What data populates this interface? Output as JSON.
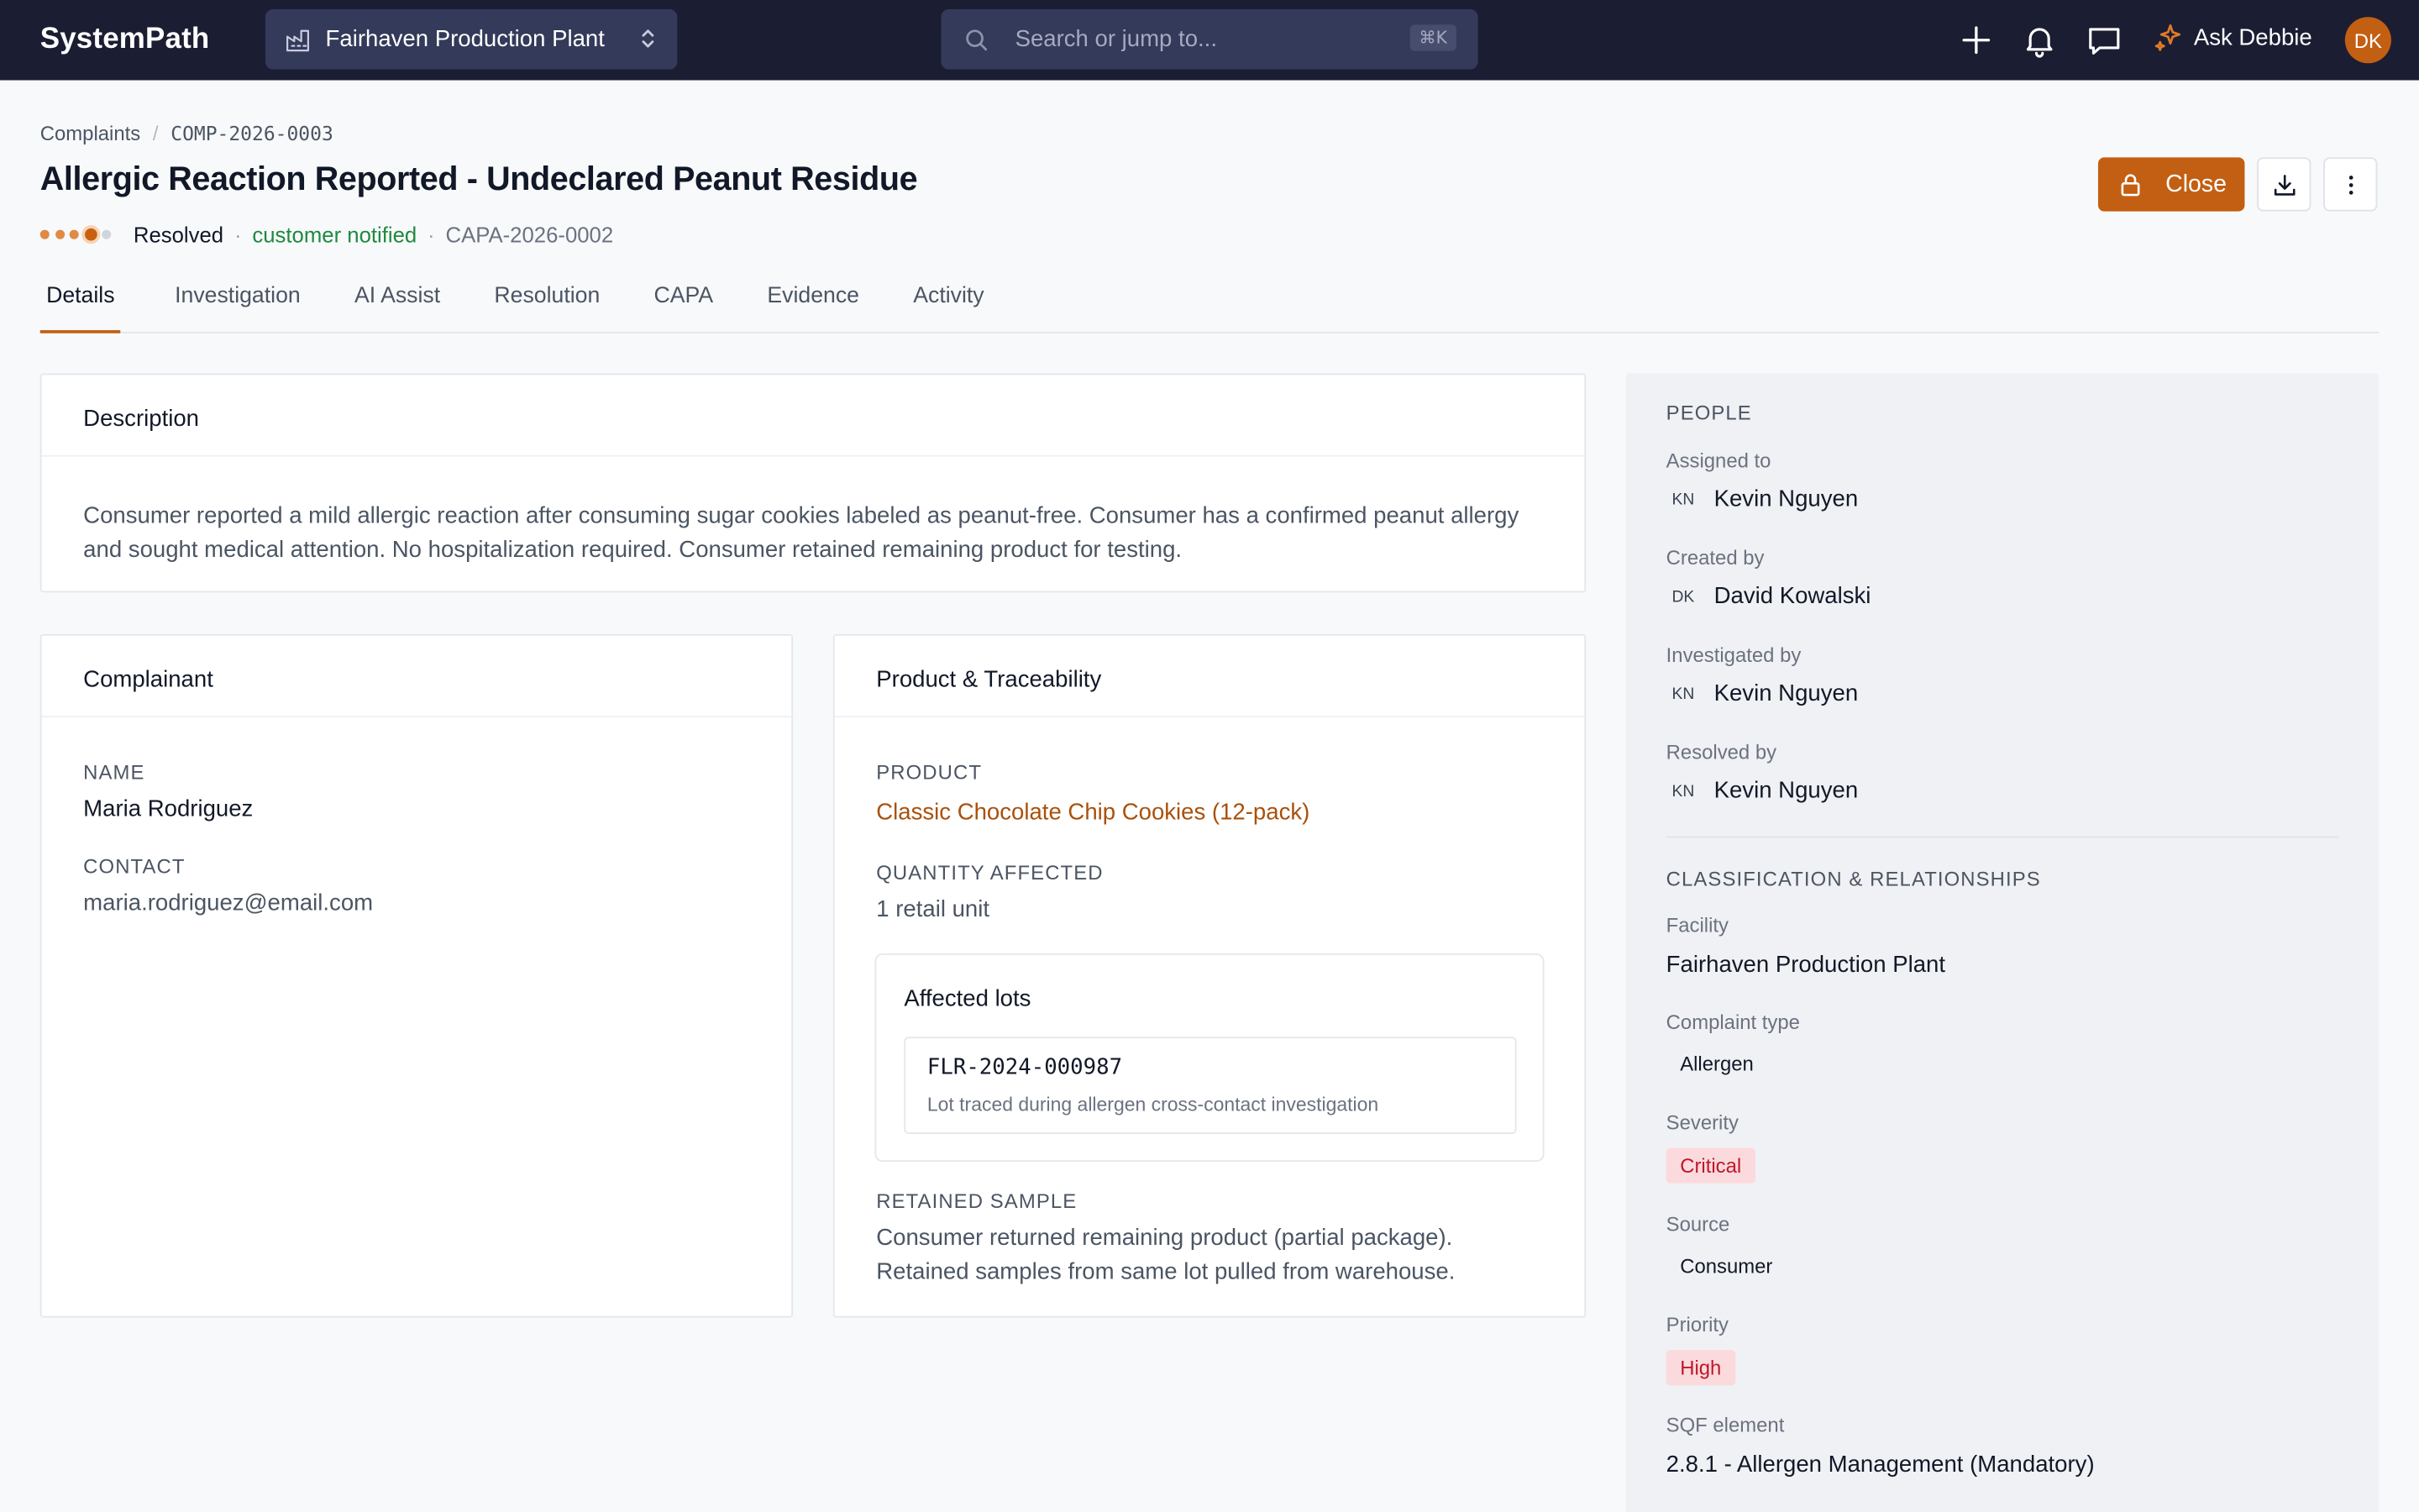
{
  "app": {
    "logo": "SystemPath",
    "facility": "Fairhaven Production Plant",
    "search_placeholder": "Search or jump to...",
    "search_shortcut": "⌘K",
    "ask_label": "Ask Debbie",
    "user_initials": "DK"
  },
  "breadcrumb": {
    "root": "Complaints",
    "current": "COMP-2026-0003"
  },
  "header": {
    "title": "Allergic Reaction Reported - Undeclared Peanut Residue",
    "status": "Resolved",
    "notified": "customer notified",
    "capa_ref": "CAPA-2026-0002",
    "close_label": "Close"
  },
  "tabs": [
    "Details",
    "Investigation",
    "AI Assist",
    "Resolution",
    "CAPA",
    "Evidence",
    "Activity"
  ],
  "description": {
    "heading": "Description",
    "text": "Consumer reported a mild allergic reaction after consuming sugar cookies labeled as peanut-free. Consumer has a confirmed peanut allergy and sought medical attention. No hospitalization required. Consumer retained remaining product for testing."
  },
  "complainant": {
    "heading": "Complainant",
    "name_label": "NAME",
    "name": "Maria Rodriguez",
    "contact_label": "CONTACT",
    "contact": "maria.rodriguez@email.com"
  },
  "product": {
    "heading": "Product & Traceability",
    "product_label": "PRODUCT",
    "product_name": "Classic Chocolate Chip Cookies (12-pack)",
    "qty_label": "QUANTITY AFFECTED",
    "qty": "1 retail unit",
    "lots_heading": "Affected lots",
    "lot_code": "FLR-2024-000987",
    "lot_note": "Lot traced during allergen cross-contact investigation",
    "retained_label": "RETAINED SAMPLE",
    "retained_line1": "Consumer returned remaining product (partial package).",
    "retained_line2": "Retained samples from same lot pulled from warehouse."
  },
  "people": {
    "heading": "PEOPLE",
    "assigned_label": "Assigned to",
    "assigned_initials": "KN",
    "assigned_name": "Kevin Nguyen",
    "created_label": "Created by",
    "created_initials": "DK",
    "created_name": "David Kowalski",
    "investigated_label": "Investigated by",
    "investigated_initials": "KN",
    "investigated_name": "Kevin Nguyen",
    "resolved_label": "Resolved by",
    "resolved_initials": "KN",
    "resolved_name": "Kevin Nguyen"
  },
  "classification": {
    "heading": "CLASSIFICATION & RELATIONSHIPS",
    "facility_label": "Facility",
    "facility": "Fairhaven Production Plant",
    "type_label": "Complaint type",
    "type": "Allergen",
    "severity_label": "Severity",
    "severity": "Critical",
    "source_label": "Source",
    "source": "Consumer",
    "priority_label": "Priority",
    "priority": "High",
    "sqf_label": "SQF element",
    "sqf": "2.8.1 - Allergen Management (Mandatory)"
  },
  "colors": {
    "topbar": "#1b1d33",
    "accent": "#c35f12",
    "success": "#1e8a3e",
    "danger": "#c0162a"
  }
}
